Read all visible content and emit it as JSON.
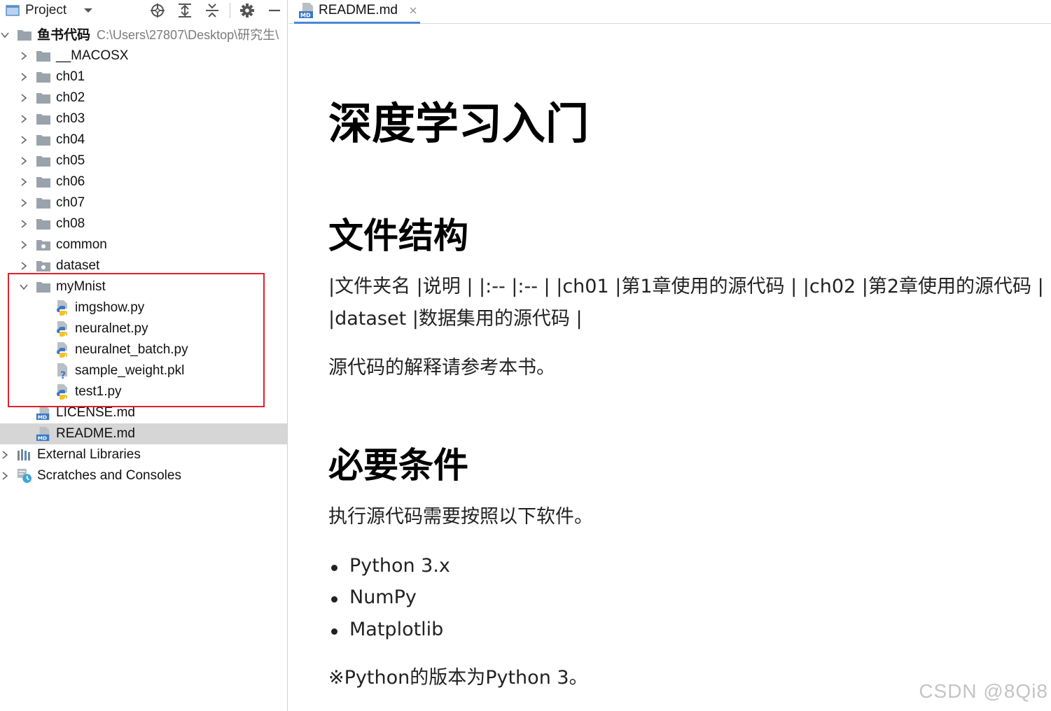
{
  "project_panel": {
    "title": "Project",
    "root": {
      "name": "鱼书代码",
      "path": "C:\\Users\\27807\\Desktop\\研究生\\"
    },
    "items": [
      {
        "label": "__MACOSX"
      },
      {
        "label": "ch01"
      },
      {
        "label": "ch02"
      },
      {
        "label": "ch03"
      },
      {
        "label": "ch04"
      },
      {
        "label": "ch05"
      },
      {
        "label": "ch06"
      },
      {
        "label": "ch07"
      },
      {
        "label": "ch08"
      },
      {
        "label": "common"
      },
      {
        "label": "dataset"
      },
      {
        "label": "myMnist"
      },
      {
        "label": "imgshow.py"
      },
      {
        "label": "neuralnet.py"
      },
      {
        "label": "neuralnet_batch.py"
      },
      {
        "label": "sample_weight.pkl"
      },
      {
        "label": "test1.py"
      },
      {
        "label": "LICENSE.md"
      },
      {
        "label": "README.md"
      }
    ],
    "external_libraries": "External Libraries",
    "scratches": "Scratches and Consoles"
  },
  "editor": {
    "tab": {
      "label": "README.md"
    },
    "doc": {
      "h1": "深度学习入门",
      "h2_structure": "文件结构",
      "table_line1": "|文件夹名 |说明 | |:-- |:-- | |ch01 |第1章使用的源代码 | |ch02 |第2章使用的源代码 | |...",
      "table_line2": "|dataset |数据集用的源代码 |",
      "p_explain": "源代码的解释请参考本书。",
      "h2_requirements": "必要条件",
      "p_software": "执行源代码需要按照以下软件。",
      "list": [
        "Python 3.x",
        "NumPy",
        "Matplotlib"
      ],
      "p_python": "※Python的版本为Python 3。"
    }
  },
  "watermark": "CSDN @8Qi8",
  "colors": {
    "selection": "#d6d6d6",
    "highlight_box": "#e0202a",
    "tab_underline": "#4a87d6",
    "folder": "#9aa3ab",
    "python_blue": "#3b78c4",
    "python_yellow": "#f2c12e"
  }
}
